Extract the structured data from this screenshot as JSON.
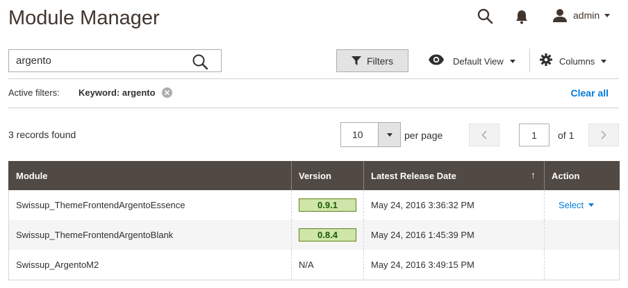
{
  "page": {
    "title": "Module Manager"
  },
  "topbar": {
    "user_name": "admin"
  },
  "search": {
    "value": "argento"
  },
  "toolbar": {
    "filters_label": "Filters",
    "view_label": "Default View",
    "columns_label": "Columns"
  },
  "active_filters": {
    "label": "Active filters:",
    "keyword_label": "Keyword:",
    "keyword_value": "argento",
    "clear_all": "Clear all"
  },
  "records": {
    "found_text": "3 records found"
  },
  "pagination": {
    "per_page_value": "10",
    "per_page_label": "per page",
    "current_page": "1",
    "total_text": "of 1"
  },
  "grid": {
    "columns": [
      "Module",
      "Version",
      "Latest Release Date",
      "Action"
    ],
    "sort_arrow": "↑",
    "rows": [
      {
        "module": "Swissup_ThemeFrontendArgentoEssence",
        "version": "0.9.1",
        "version_badge": true,
        "date": "May 24, 2016 3:36:32 PM",
        "action": "Select"
      },
      {
        "module": "Swissup_ThemeFrontendArgentoBlank",
        "version": "0.8.4",
        "version_badge": true,
        "date": "May 24, 2016 1:45:39 PM",
        "action": ""
      },
      {
        "module": "Swissup_ArgentoM2",
        "version": "N/A",
        "version_badge": false,
        "date": "May 24, 2016 3:49:15 PM",
        "action": ""
      }
    ]
  },
  "colors": {
    "header_bg": "#514943",
    "link": "#007bdb",
    "badge_bg": "#d0e5a9",
    "badge_border": "#5b8116"
  }
}
